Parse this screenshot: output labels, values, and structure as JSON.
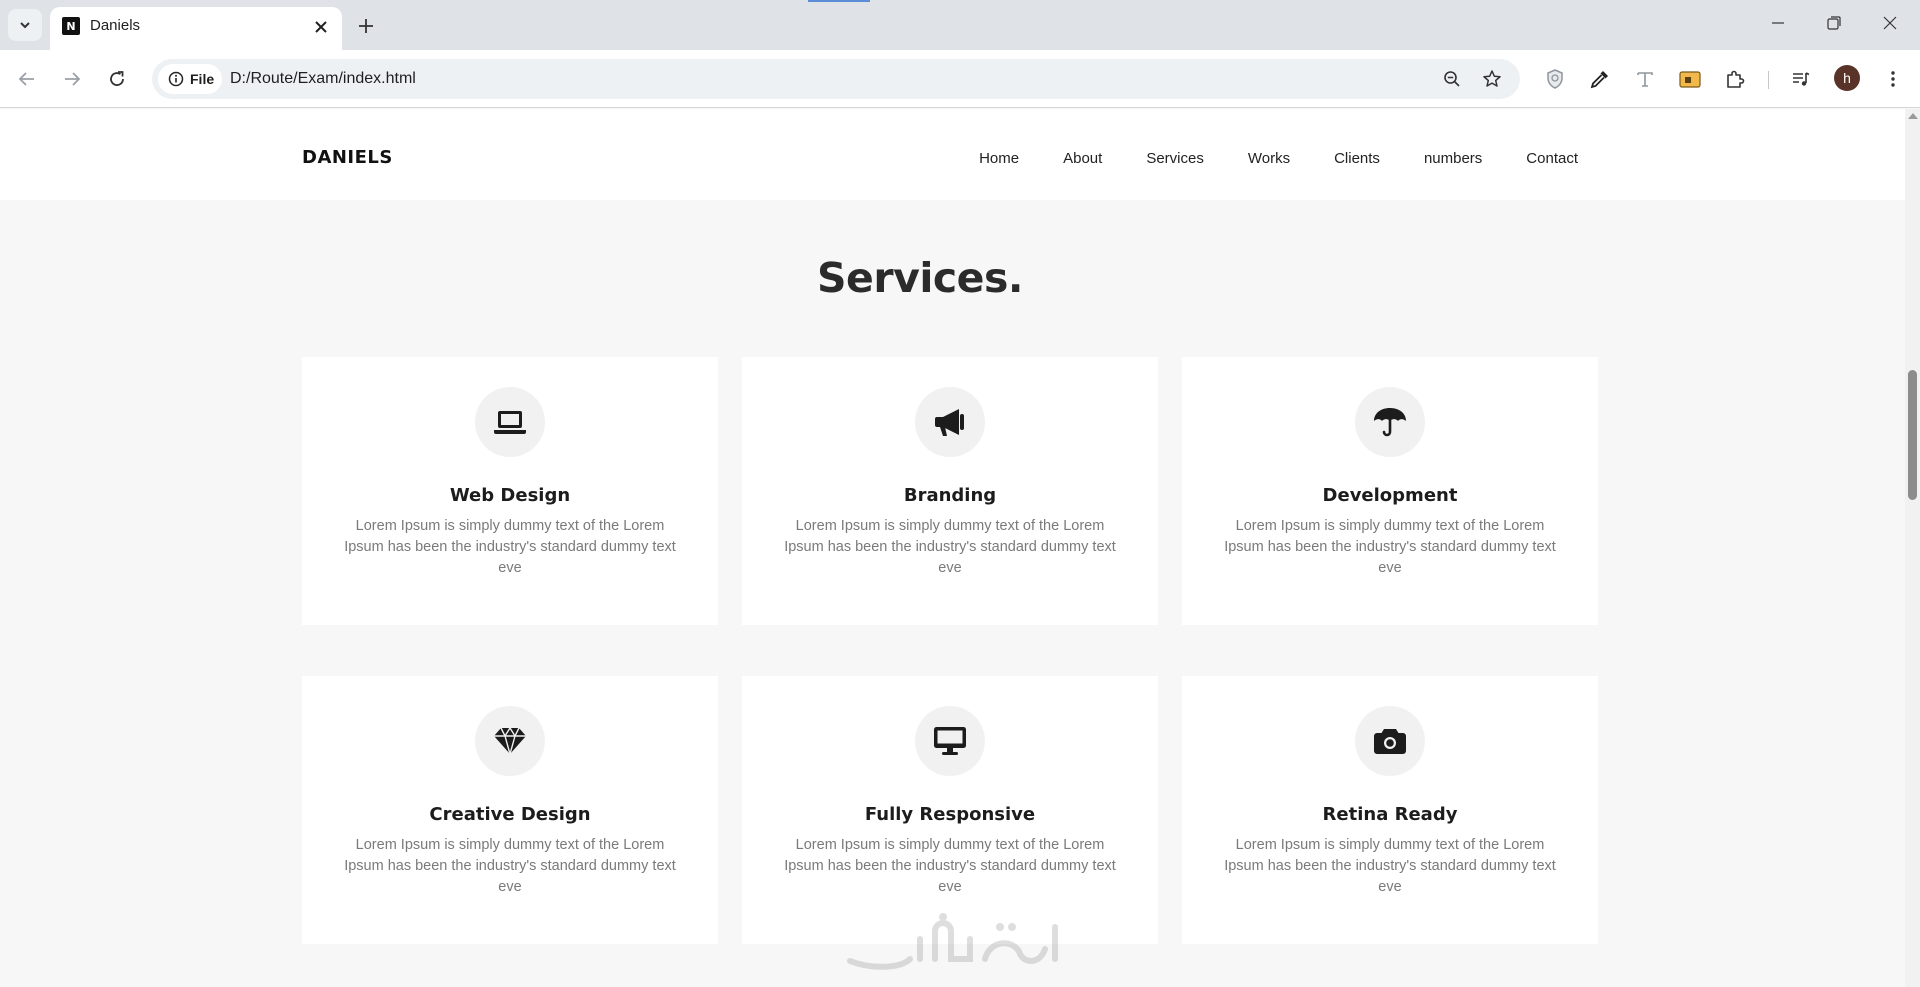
{
  "browser": {
    "tab_title": "Daniels",
    "site_chip_label": "File",
    "url": "D:/Route/Exam/index.html",
    "profile_initial": "h"
  },
  "site": {
    "brand": "DANIELS",
    "nav": [
      "Home",
      "About",
      "Services",
      "Works",
      "Clients",
      "numbers",
      "Contact"
    ]
  },
  "services": {
    "title": "Services.",
    "cards": [
      {
        "title": "Web Design",
        "icon": "laptop-icon",
        "text": "Lorem Ipsum is simply dummy text of the Lorem Ipsum has been the industry's standard dummy text eve"
      },
      {
        "title": "Branding",
        "icon": "bullhorn-icon",
        "text": "Lorem Ipsum is simply dummy text of the Lorem Ipsum has been the industry's standard dummy text eve"
      },
      {
        "title": "Development",
        "icon": "umbrella-icon",
        "text": "Lorem Ipsum is simply dummy text of the Lorem Ipsum has been the industry's standard dummy text eve"
      },
      {
        "title": "Creative Design",
        "icon": "gem-icon",
        "text": "Lorem Ipsum is simply dummy text of the Lorem Ipsum has been the industry's standard dummy text eve"
      },
      {
        "title": "Fully Responsive",
        "icon": "desktop-icon",
        "text": "Lorem Ipsum is simply dummy text of the Lorem Ipsum has been the industry's standard dummy text eve"
      },
      {
        "title": "Retina Ready",
        "icon": "camera-icon",
        "text": "Lorem Ipsum is simply dummy text of the Lorem Ipsum has been the industry's standard dummy text eve"
      }
    ]
  },
  "colors": {
    "page_bg": "#f7f7f7",
    "card_bg": "#ffffff",
    "icon_circle": "#f1f1f1",
    "heading": "#2b2b2b",
    "body_text": "#7a7a7a"
  }
}
